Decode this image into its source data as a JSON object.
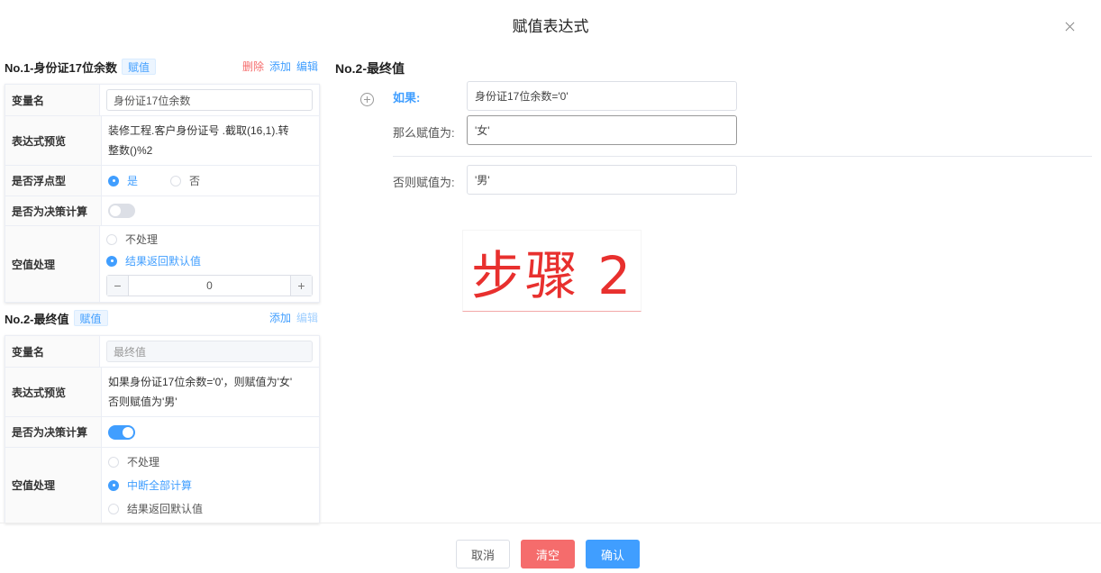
{
  "dialog": {
    "title": "赋值表达式"
  },
  "section1": {
    "title": "No.1-身份证17位余数",
    "tag": "赋值",
    "actions": {
      "delete": "删除",
      "add": "添加",
      "edit": "编辑"
    },
    "rows": {
      "var_name_label": "变量名",
      "var_name_value": "身份证17位余数",
      "expr_label": "表达式预览",
      "expr_line1": "装修工程.客户身份证号 .截取(16,1).转",
      "expr_line2": "整数()%2",
      "float_label": "是否浮点型",
      "float_yes": "是",
      "float_no": "否",
      "float_selected": "是",
      "decision_label": "是否为决策计算",
      "decision_on": false,
      "null_label": "空值处理",
      "null_opt1": "不处理",
      "null_opt2": "结果返回默认值",
      "null_selected": "结果返回默认值",
      "stepper_value": "0"
    }
  },
  "section2": {
    "title": "No.2-最终值",
    "tag": "赋值",
    "actions": {
      "add": "添加",
      "edit": "编辑"
    },
    "rows": {
      "var_name_label": "变量名",
      "var_name_value": "最终值",
      "expr_label": "表达式预览",
      "expr_line1": "如果身份证17位余数='0'，则赋值为'女'",
      "expr_line2": "否则赋值为'男'",
      "decision_label": "是否为决策计算",
      "decision_on": true,
      "null_label": "空值处理",
      "null_opt1": "不处理",
      "null_opt2": "中断全部计算",
      "null_opt3": "结果返回默认值",
      "null_selected": "中断全部计算"
    }
  },
  "editor": {
    "title": "No.2-最终值",
    "if_label": "如果:",
    "if_value": "身份证17位余数='0'",
    "then_label": "那么赋值为:",
    "then_value": "'女'",
    "else_label": "否则赋值为:",
    "else_value": "'男'"
  },
  "annotation": {
    "text": "步骤 2"
  },
  "footer": {
    "cancel": "取消",
    "clear": "清空",
    "confirm": "确认"
  },
  "colors": {
    "primary": "#409eff",
    "danger": "#f56c6c",
    "annotation": "#e8302e"
  }
}
